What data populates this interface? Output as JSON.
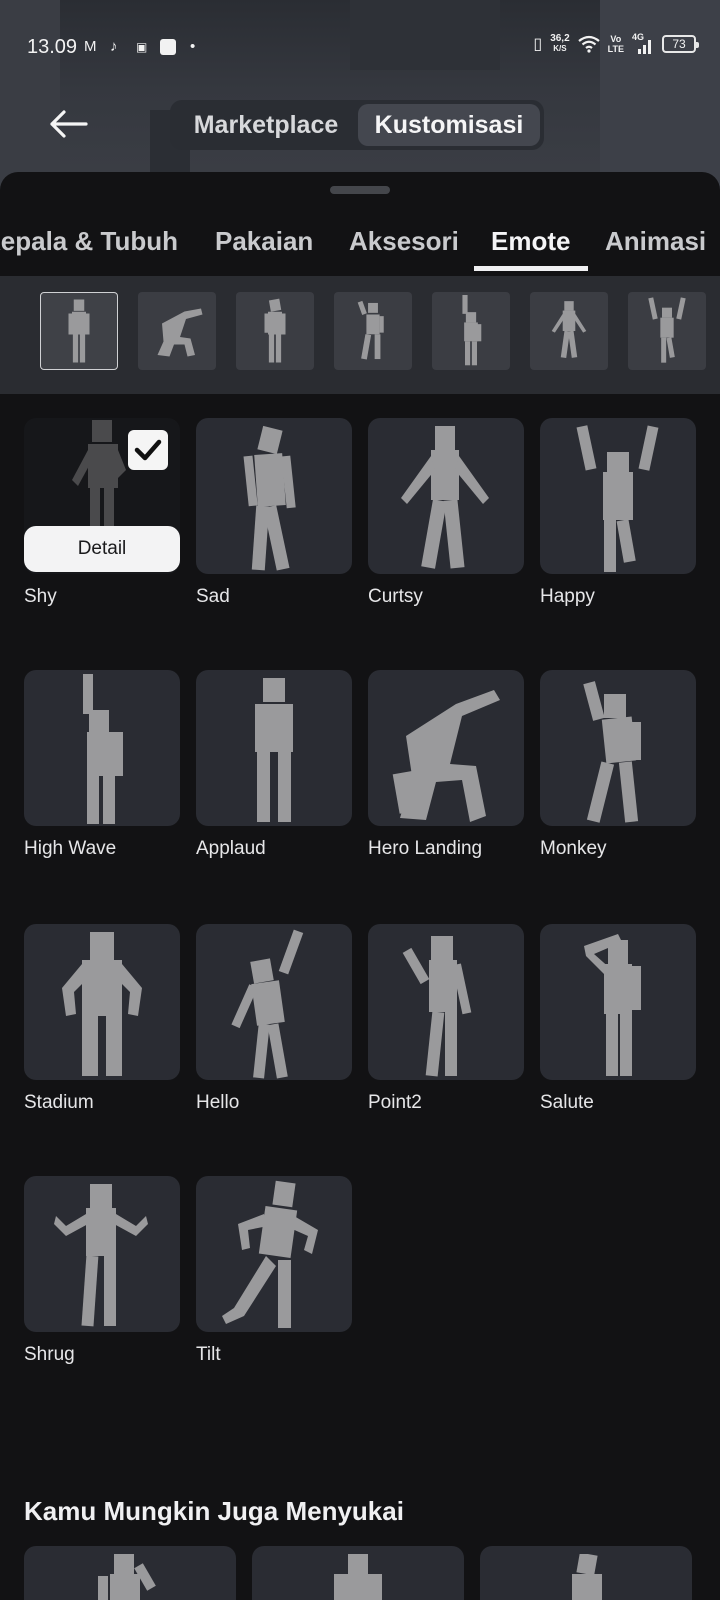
{
  "status_bar": {
    "time": "13.09",
    "net_speed_value": "36,2",
    "net_speed_unit": "K/S",
    "volte_top": "Vo",
    "volte_bottom": "LTE",
    "network": "4G",
    "battery": "73"
  },
  "header": {
    "segments": [
      {
        "label": "Marketplace",
        "selected": false
      },
      {
        "label": "Kustomisasi",
        "selected": true
      }
    ]
  },
  "category_tabs": [
    {
      "label": "Kepala & Tubuh",
      "active": false
    },
    {
      "label": "Pakaian",
      "active": false
    },
    {
      "label": "Aksesori",
      "active": false
    },
    {
      "label": "Emote",
      "active": true
    },
    {
      "label": "Animasi",
      "active": false
    }
  ],
  "emote_slots": [
    {
      "icon": "standing-avatar-icon",
      "selected": true
    },
    {
      "icon": "hero-landing-avatar-icon",
      "selected": false
    },
    {
      "icon": "standing-avatar-icon",
      "selected": false
    },
    {
      "icon": "monkey-avatar-icon",
      "selected": false
    },
    {
      "icon": "wave-avatar-icon",
      "selected": false
    },
    {
      "icon": "curtsy-avatar-icon",
      "selected": false
    },
    {
      "icon": "happy-avatar-icon",
      "selected": false
    }
  ],
  "emotes": [
    {
      "name": "Shy",
      "equipped": true,
      "detail_label": "Detail"
    },
    {
      "name": "Sad"
    },
    {
      "name": "Curtsy"
    },
    {
      "name": "Happy"
    },
    {
      "name": "High Wave"
    },
    {
      "name": "Applaud"
    },
    {
      "name": "Hero Landing"
    },
    {
      "name": "Monkey"
    },
    {
      "name": "Stadium"
    },
    {
      "name": "Hello"
    },
    {
      "name": "Point2"
    },
    {
      "name": "Salute"
    },
    {
      "name": "Shrug"
    },
    {
      "name": "Tilt"
    }
  ],
  "recommendations": {
    "title": "Kamu Mungkin Juga Menyukai"
  },
  "colors": {
    "background": "#121214",
    "tile": "#2a2c33",
    "figure": "#9a9a9c"
  }
}
